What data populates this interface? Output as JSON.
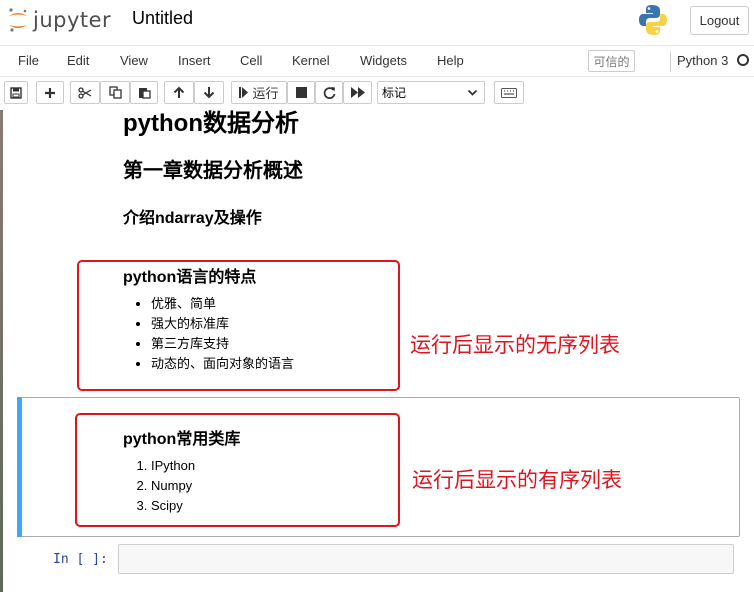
{
  "header": {
    "logo_text": "jupyter",
    "notebook_title": "Untitled",
    "logout_label": "Logout"
  },
  "menubar": {
    "items": [
      "File",
      "Edit",
      "View",
      "Insert",
      "Cell",
      "Kernel",
      "Widgets",
      "Help"
    ],
    "trusted_label": "可信的",
    "kernel_name": "Python 3"
  },
  "toolbar": {
    "run_label": "运行",
    "cell_type": "标记",
    "icons": [
      "save-icon",
      "plus-icon",
      "cut-icon",
      "copy-icon",
      "paste-icon",
      "arrow-up-icon",
      "arrow-down-icon",
      "run-icon",
      "stop-icon",
      "restart-icon",
      "fast-forward-icon",
      "keyboard-icon"
    ]
  },
  "cells": {
    "h1": "python数据分析",
    "h2": "第一章数据分析概述",
    "h3": "介绍ndarray及操作",
    "unordered": {
      "heading": "python语言的特点",
      "items": [
        "优雅、简单",
        "强大的标准库",
        "第三方库支持",
        "动态的、面向对象的语言"
      ]
    },
    "ordered": {
      "heading": "python常用类库",
      "items": [
        "IPython",
        "Numpy",
        "Scipy"
      ]
    },
    "empty_prompt": "In [ ]:"
  },
  "annotations": {
    "unordered_note": "运行后显示的无序列表",
    "ordered_note": "运行后显示的有序列表",
    "color": "#e0141e"
  },
  "colors": {
    "selected_cell_bar": "#42a5f5",
    "prompt": "#303f9f",
    "logo_orange": "#f37726"
  }
}
